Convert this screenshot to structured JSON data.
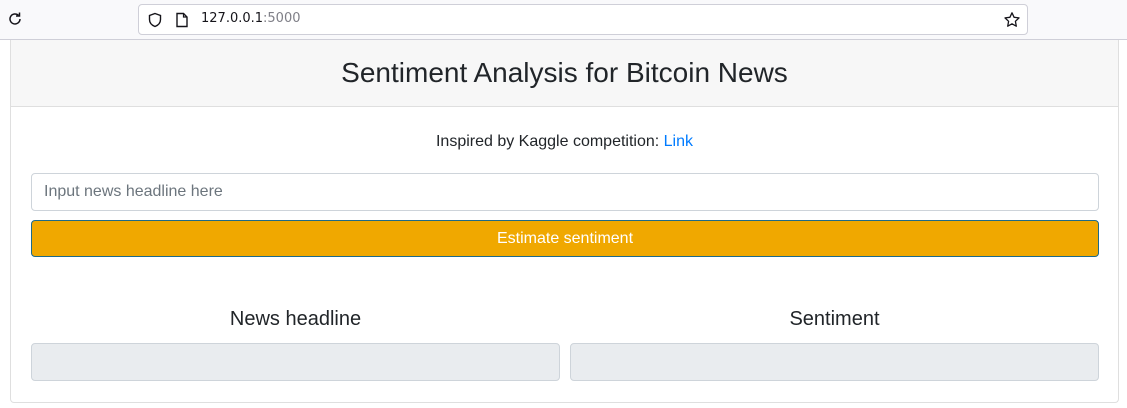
{
  "browser": {
    "url_host": "127.0.0.1",
    "url_port": ":5000"
  },
  "page": {
    "title": "Sentiment Analysis for Bitcoin News",
    "inspired_text": "Inspired by Kaggle competition: ",
    "inspired_link": "Link",
    "input_placeholder": "Input news headline here",
    "input_value": "",
    "button_label": "Estimate sentiment",
    "col_headline": "News headline",
    "col_sentiment": "Sentiment",
    "headline_output": "",
    "sentiment_output": ""
  },
  "colors": {
    "button_bg": "#f0a800",
    "link": "#007bff",
    "output_bg": "#e9ecef"
  }
}
